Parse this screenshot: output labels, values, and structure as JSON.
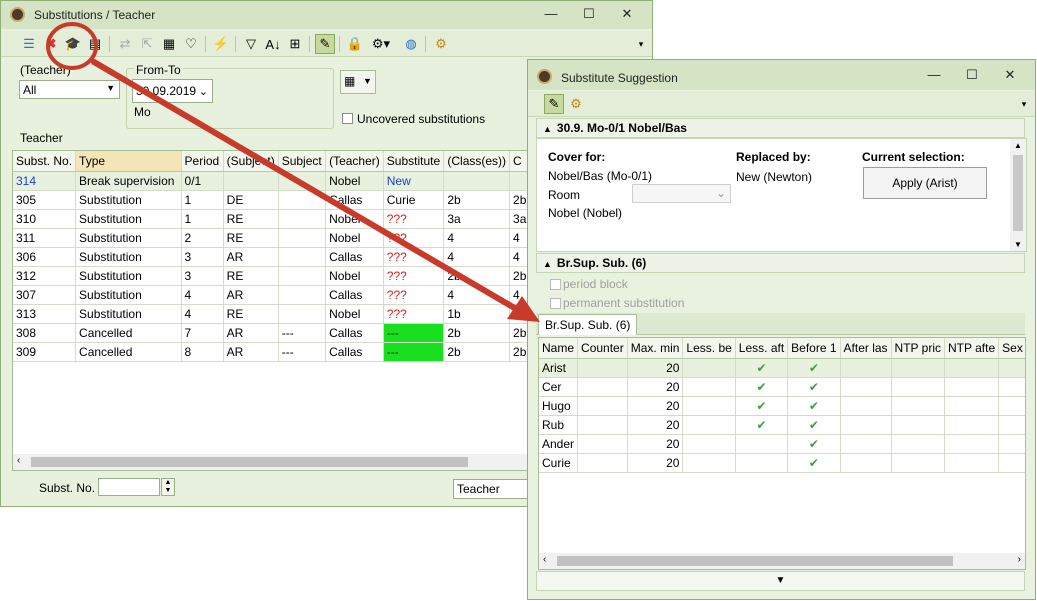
{
  "main_window": {
    "title": "Substitutions / Teacher",
    "window_buttons": [
      "—",
      "☐",
      "✕"
    ],
    "teacher_filter_label": "(Teacher)",
    "teacher_filter_value": "All",
    "from_to_label": "From-To",
    "date_value": "30.09.2019",
    "day_label": "Mo",
    "uncovered_label": "Uncovered substitutions",
    "teacher_label": "Teacher",
    "columns": [
      "Subst. No.",
      "Type",
      "Period",
      "(Subject)",
      "Subject",
      "(Teacher)",
      "Substitute",
      "(Class(es))",
      "C"
    ],
    "rows": [
      {
        "no": "314",
        "type": "Break supervision",
        "period": "0/1",
        "subj": "",
        "subject": "",
        "teacher": "Nobel",
        "substitute": "New",
        "classes": "",
        "c": ""
      },
      {
        "no": "305",
        "type": "Substitution",
        "period": "1",
        "subj": "DE",
        "subject": "",
        "teacher": "Callas",
        "substitute": "Curie",
        "classes": "2b",
        "c": "2b"
      },
      {
        "no": "310",
        "type": "Substitution",
        "period": "1",
        "subj": "RE",
        "subject": "",
        "teacher": "Nobel",
        "substitute": "???",
        "classes": "3a",
        "c": "3a"
      },
      {
        "no": "311",
        "type": "Substitution",
        "period": "2",
        "subj": "RE",
        "subject": "",
        "teacher": "Nobel",
        "substitute": "???",
        "classes": "4",
        "c": "4"
      },
      {
        "no": "306",
        "type": "Substitution",
        "period": "3",
        "subj": "AR",
        "subject": "",
        "teacher": "Callas",
        "substitute": "???",
        "classes": "4",
        "c": "4"
      },
      {
        "no": "312",
        "type": "Substitution",
        "period": "3",
        "subj": "RE",
        "subject": "",
        "teacher": "Nobel",
        "substitute": "???",
        "classes": "2b",
        "c": "2b"
      },
      {
        "no": "307",
        "type": "Substitution",
        "period": "4",
        "subj": "AR",
        "subject": "",
        "teacher": "Callas",
        "substitute": "???",
        "classes": "4",
        "c": "4"
      },
      {
        "no": "313",
        "type": "Substitution",
        "period": "4",
        "subj": "RE",
        "subject": "",
        "teacher": "Nobel",
        "substitute": "???",
        "classes": "1b",
        "c": "1b"
      },
      {
        "no": "308",
        "type": "Cancelled",
        "period": "7",
        "subj": "AR",
        "subject": "---",
        "teacher": "Callas",
        "substitute": "---",
        "classes": "2b",
        "c": "2b"
      },
      {
        "no": "309",
        "type": "Cancelled",
        "period": "8",
        "subj": "AR",
        "subject": "---",
        "teacher": "Callas",
        "substitute": "---",
        "classes": "2b",
        "c": "2b"
      }
    ],
    "subst_no_label": "Subst. No.",
    "subst_no_value": "",
    "view_select": "Teacher"
  },
  "suggestion_window": {
    "title": "Substitute Suggestion",
    "window_buttons": [
      "—",
      "☐",
      "✕"
    ],
    "section1_title": "30.9. Mo-0/1 Nobel/Bas",
    "cover_for_label": "Cover for:",
    "cover_for_value": "Nobel/Bas (Mo-0/1)",
    "room_label": "Room",
    "room_value": "",
    "teacher_value": "Nobel (Nobel)",
    "replaced_by_label": "Replaced by:",
    "replaced_by_value": "New (Newton)",
    "current_selection_label": "Current selection:",
    "apply_button": "Apply (Arist)",
    "section2_title": "Br.Sup. Sub. (6)",
    "period_block_label": "period block",
    "permanent_label": "permanent substitution",
    "tab_label": "Br.Sup. Sub. (6)",
    "columns": [
      "Name",
      "Counter",
      "Max. min",
      "Less. be",
      "Less. aft",
      "Before 1",
      "After las",
      "NTP pric",
      "NTP afte",
      "Sex"
    ],
    "rows": [
      {
        "name": "Arist",
        "counter": "",
        "max": "20",
        "less_be": "",
        "less_aft": "✔",
        "before1": "✔",
        "after_last": "",
        "ntp_prior": "",
        "ntp_after": "",
        "sex": ""
      },
      {
        "name": "Cer",
        "counter": "",
        "max": "20",
        "less_be": "",
        "less_aft": "✔",
        "before1": "✔",
        "after_last": "",
        "ntp_prior": "",
        "ntp_after": "",
        "sex": ""
      },
      {
        "name": "Hugo",
        "counter": "",
        "max": "20",
        "less_be": "",
        "less_aft": "✔",
        "before1": "✔",
        "after_last": "",
        "ntp_prior": "",
        "ntp_after": "",
        "sex": ""
      },
      {
        "name": "Rub",
        "counter": "",
        "max": "20",
        "less_be": "",
        "less_aft": "✔",
        "before1": "✔",
        "after_last": "",
        "ntp_prior": "",
        "ntp_after": "",
        "sex": ""
      },
      {
        "name": "Ander",
        "counter": "",
        "max": "20",
        "less_be": "",
        "less_aft": "",
        "before1": "✔",
        "after_last": "",
        "ntp_prior": "",
        "ntp_after": "",
        "sex": ""
      },
      {
        "name": "Curie",
        "counter": "",
        "max": "20",
        "less_be": "",
        "less_aft": "",
        "before1": "✔",
        "after_last": "",
        "ntp_prior": "",
        "ntp_after": "",
        "sex": ""
      }
    ]
  },
  "colors": {
    "annotation_red": "#c83a2a",
    "window_bg": "#e8f0de",
    "titlebar_bg": "#d5e4c5",
    "uncovered_green": "#19e01e",
    "missing_red": "#e02020",
    "new_blue": "#1a3fd8",
    "check_green": "#3aa13a",
    "highlight": "#f5e6ba"
  }
}
